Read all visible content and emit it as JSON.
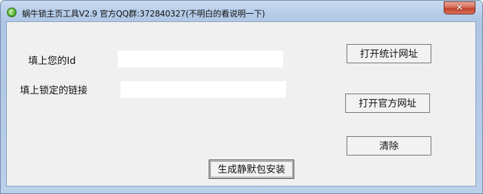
{
  "window": {
    "title": "蜗牛锁主页工具V2.9 官方QQ群:372840327(不明白的看说明一下)",
    "close_symbol": "✕"
  },
  "form": {
    "id_label": "填上您的Id",
    "id_value": "",
    "link_label": "填上锁定的链接",
    "link_value": ""
  },
  "buttons": {
    "open_stats": "打开统计网址",
    "open_official": "打开官方网址",
    "clear": "清除",
    "generate": "生成静默包安装"
  },
  "colors": {
    "window_frame": "#b9cfea",
    "client_bg": "#f0f0f0",
    "close_button": "#c2412b",
    "app_icon": "#4fae2f"
  }
}
